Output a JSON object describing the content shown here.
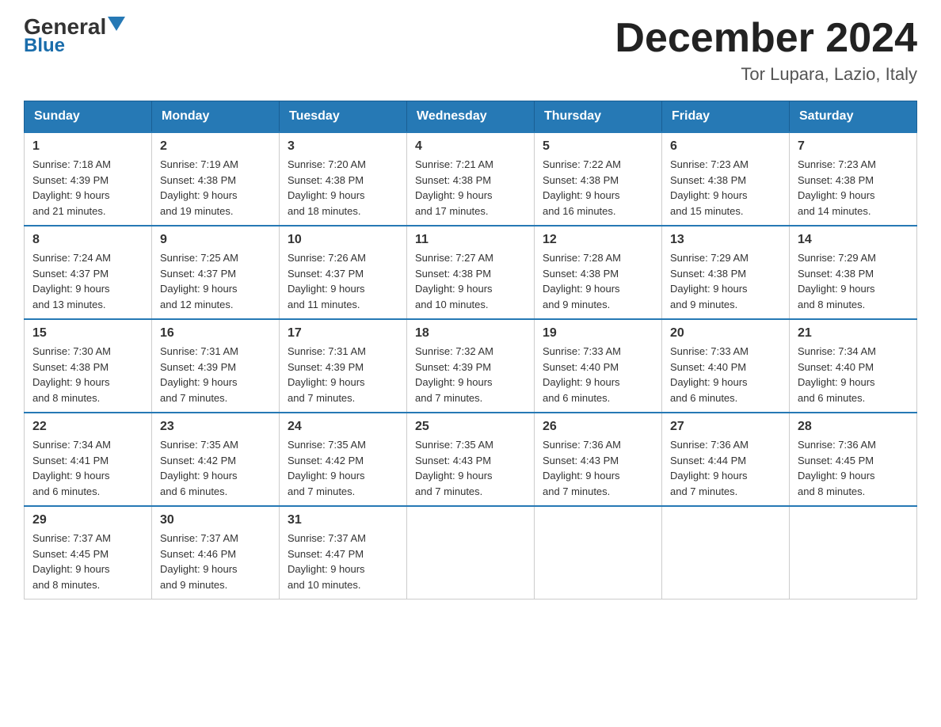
{
  "header": {
    "logo_general": "General",
    "logo_blue": "Blue",
    "month_title": "December 2024",
    "location": "Tor Lupara, Lazio, Italy"
  },
  "days_of_week": [
    "Sunday",
    "Monday",
    "Tuesday",
    "Wednesday",
    "Thursday",
    "Friday",
    "Saturday"
  ],
  "weeks": [
    [
      {
        "day": "1",
        "sunrise": "7:18 AM",
        "sunset": "4:39 PM",
        "daylight": "9 hours and 21 minutes."
      },
      {
        "day": "2",
        "sunrise": "7:19 AM",
        "sunset": "4:38 PM",
        "daylight": "9 hours and 19 minutes."
      },
      {
        "day": "3",
        "sunrise": "7:20 AM",
        "sunset": "4:38 PM",
        "daylight": "9 hours and 18 minutes."
      },
      {
        "day": "4",
        "sunrise": "7:21 AM",
        "sunset": "4:38 PM",
        "daylight": "9 hours and 17 minutes."
      },
      {
        "day": "5",
        "sunrise": "7:22 AM",
        "sunset": "4:38 PM",
        "daylight": "9 hours and 16 minutes."
      },
      {
        "day": "6",
        "sunrise": "7:23 AM",
        "sunset": "4:38 PM",
        "daylight": "9 hours and 15 minutes."
      },
      {
        "day": "7",
        "sunrise": "7:23 AM",
        "sunset": "4:38 PM",
        "daylight": "9 hours and 14 minutes."
      }
    ],
    [
      {
        "day": "8",
        "sunrise": "7:24 AM",
        "sunset": "4:37 PM",
        "daylight": "9 hours and 13 minutes."
      },
      {
        "day": "9",
        "sunrise": "7:25 AM",
        "sunset": "4:37 PM",
        "daylight": "9 hours and 12 minutes."
      },
      {
        "day": "10",
        "sunrise": "7:26 AM",
        "sunset": "4:37 PM",
        "daylight": "9 hours and 11 minutes."
      },
      {
        "day": "11",
        "sunrise": "7:27 AM",
        "sunset": "4:38 PM",
        "daylight": "9 hours and 10 minutes."
      },
      {
        "day": "12",
        "sunrise": "7:28 AM",
        "sunset": "4:38 PM",
        "daylight": "9 hours and 9 minutes."
      },
      {
        "day": "13",
        "sunrise": "7:29 AM",
        "sunset": "4:38 PM",
        "daylight": "9 hours and 9 minutes."
      },
      {
        "day": "14",
        "sunrise": "7:29 AM",
        "sunset": "4:38 PM",
        "daylight": "9 hours and 8 minutes."
      }
    ],
    [
      {
        "day": "15",
        "sunrise": "7:30 AM",
        "sunset": "4:38 PM",
        "daylight": "9 hours and 8 minutes."
      },
      {
        "day": "16",
        "sunrise": "7:31 AM",
        "sunset": "4:39 PM",
        "daylight": "9 hours and 7 minutes."
      },
      {
        "day": "17",
        "sunrise": "7:31 AM",
        "sunset": "4:39 PM",
        "daylight": "9 hours and 7 minutes."
      },
      {
        "day": "18",
        "sunrise": "7:32 AM",
        "sunset": "4:39 PM",
        "daylight": "9 hours and 7 minutes."
      },
      {
        "day": "19",
        "sunrise": "7:33 AM",
        "sunset": "4:40 PM",
        "daylight": "9 hours and 6 minutes."
      },
      {
        "day": "20",
        "sunrise": "7:33 AM",
        "sunset": "4:40 PM",
        "daylight": "9 hours and 6 minutes."
      },
      {
        "day": "21",
        "sunrise": "7:34 AM",
        "sunset": "4:40 PM",
        "daylight": "9 hours and 6 minutes."
      }
    ],
    [
      {
        "day": "22",
        "sunrise": "7:34 AM",
        "sunset": "4:41 PM",
        "daylight": "9 hours and 6 minutes."
      },
      {
        "day": "23",
        "sunrise": "7:35 AM",
        "sunset": "4:42 PM",
        "daylight": "9 hours and 6 minutes."
      },
      {
        "day": "24",
        "sunrise": "7:35 AM",
        "sunset": "4:42 PM",
        "daylight": "9 hours and 7 minutes."
      },
      {
        "day": "25",
        "sunrise": "7:35 AM",
        "sunset": "4:43 PM",
        "daylight": "9 hours and 7 minutes."
      },
      {
        "day": "26",
        "sunrise": "7:36 AM",
        "sunset": "4:43 PM",
        "daylight": "9 hours and 7 minutes."
      },
      {
        "day": "27",
        "sunrise": "7:36 AM",
        "sunset": "4:44 PM",
        "daylight": "9 hours and 7 minutes."
      },
      {
        "day": "28",
        "sunrise": "7:36 AM",
        "sunset": "4:45 PM",
        "daylight": "9 hours and 8 minutes."
      }
    ],
    [
      {
        "day": "29",
        "sunrise": "7:37 AM",
        "sunset": "4:45 PM",
        "daylight": "9 hours and 8 minutes."
      },
      {
        "day": "30",
        "sunrise": "7:37 AM",
        "sunset": "4:46 PM",
        "daylight": "9 hours and 9 minutes."
      },
      {
        "day": "31",
        "sunrise": "7:37 AM",
        "sunset": "4:47 PM",
        "daylight": "9 hours and 10 minutes."
      },
      null,
      null,
      null,
      null
    ]
  ],
  "labels": {
    "sunrise": "Sunrise:",
    "sunset": "Sunset:",
    "daylight": "Daylight:"
  }
}
